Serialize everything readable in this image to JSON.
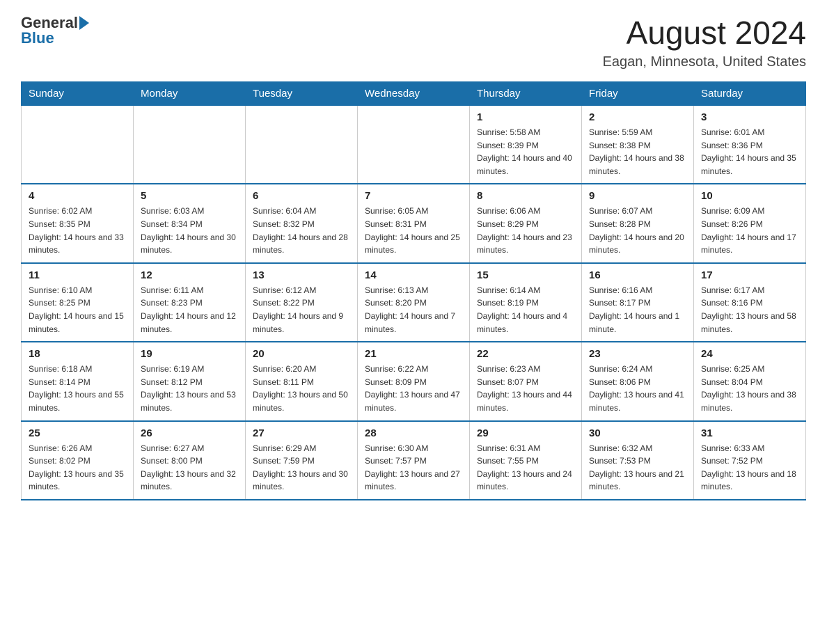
{
  "header": {
    "logo_text_general": "General",
    "logo_text_blue": "Blue",
    "month_year": "August 2024",
    "location": "Eagan, Minnesota, United States"
  },
  "days_of_week": [
    "Sunday",
    "Monday",
    "Tuesday",
    "Wednesday",
    "Thursday",
    "Friday",
    "Saturday"
  ],
  "weeks": [
    [
      {
        "day": "",
        "info": ""
      },
      {
        "day": "",
        "info": ""
      },
      {
        "day": "",
        "info": ""
      },
      {
        "day": "",
        "info": ""
      },
      {
        "day": "1",
        "info": "Sunrise: 5:58 AM\nSunset: 8:39 PM\nDaylight: 14 hours and 40 minutes."
      },
      {
        "day": "2",
        "info": "Sunrise: 5:59 AM\nSunset: 8:38 PM\nDaylight: 14 hours and 38 minutes."
      },
      {
        "day": "3",
        "info": "Sunrise: 6:01 AM\nSunset: 8:36 PM\nDaylight: 14 hours and 35 minutes."
      }
    ],
    [
      {
        "day": "4",
        "info": "Sunrise: 6:02 AM\nSunset: 8:35 PM\nDaylight: 14 hours and 33 minutes."
      },
      {
        "day": "5",
        "info": "Sunrise: 6:03 AM\nSunset: 8:34 PM\nDaylight: 14 hours and 30 minutes."
      },
      {
        "day": "6",
        "info": "Sunrise: 6:04 AM\nSunset: 8:32 PM\nDaylight: 14 hours and 28 minutes."
      },
      {
        "day": "7",
        "info": "Sunrise: 6:05 AM\nSunset: 8:31 PM\nDaylight: 14 hours and 25 minutes."
      },
      {
        "day": "8",
        "info": "Sunrise: 6:06 AM\nSunset: 8:29 PM\nDaylight: 14 hours and 23 minutes."
      },
      {
        "day": "9",
        "info": "Sunrise: 6:07 AM\nSunset: 8:28 PM\nDaylight: 14 hours and 20 minutes."
      },
      {
        "day": "10",
        "info": "Sunrise: 6:09 AM\nSunset: 8:26 PM\nDaylight: 14 hours and 17 minutes."
      }
    ],
    [
      {
        "day": "11",
        "info": "Sunrise: 6:10 AM\nSunset: 8:25 PM\nDaylight: 14 hours and 15 minutes."
      },
      {
        "day": "12",
        "info": "Sunrise: 6:11 AM\nSunset: 8:23 PM\nDaylight: 14 hours and 12 minutes."
      },
      {
        "day": "13",
        "info": "Sunrise: 6:12 AM\nSunset: 8:22 PM\nDaylight: 14 hours and 9 minutes."
      },
      {
        "day": "14",
        "info": "Sunrise: 6:13 AM\nSunset: 8:20 PM\nDaylight: 14 hours and 7 minutes."
      },
      {
        "day": "15",
        "info": "Sunrise: 6:14 AM\nSunset: 8:19 PM\nDaylight: 14 hours and 4 minutes."
      },
      {
        "day": "16",
        "info": "Sunrise: 6:16 AM\nSunset: 8:17 PM\nDaylight: 14 hours and 1 minute."
      },
      {
        "day": "17",
        "info": "Sunrise: 6:17 AM\nSunset: 8:16 PM\nDaylight: 13 hours and 58 minutes."
      }
    ],
    [
      {
        "day": "18",
        "info": "Sunrise: 6:18 AM\nSunset: 8:14 PM\nDaylight: 13 hours and 55 minutes."
      },
      {
        "day": "19",
        "info": "Sunrise: 6:19 AM\nSunset: 8:12 PM\nDaylight: 13 hours and 53 minutes."
      },
      {
        "day": "20",
        "info": "Sunrise: 6:20 AM\nSunset: 8:11 PM\nDaylight: 13 hours and 50 minutes."
      },
      {
        "day": "21",
        "info": "Sunrise: 6:22 AM\nSunset: 8:09 PM\nDaylight: 13 hours and 47 minutes."
      },
      {
        "day": "22",
        "info": "Sunrise: 6:23 AM\nSunset: 8:07 PM\nDaylight: 13 hours and 44 minutes."
      },
      {
        "day": "23",
        "info": "Sunrise: 6:24 AM\nSunset: 8:06 PM\nDaylight: 13 hours and 41 minutes."
      },
      {
        "day": "24",
        "info": "Sunrise: 6:25 AM\nSunset: 8:04 PM\nDaylight: 13 hours and 38 minutes."
      }
    ],
    [
      {
        "day": "25",
        "info": "Sunrise: 6:26 AM\nSunset: 8:02 PM\nDaylight: 13 hours and 35 minutes."
      },
      {
        "day": "26",
        "info": "Sunrise: 6:27 AM\nSunset: 8:00 PM\nDaylight: 13 hours and 32 minutes."
      },
      {
        "day": "27",
        "info": "Sunrise: 6:29 AM\nSunset: 7:59 PM\nDaylight: 13 hours and 30 minutes."
      },
      {
        "day": "28",
        "info": "Sunrise: 6:30 AM\nSunset: 7:57 PM\nDaylight: 13 hours and 27 minutes."
      },
      {
        "day": "29",
        "info": "Sunrise: 6:31 AM\nSunset: 7:55 PM\nDaylight: 13 hours and 24 minutes."
      },
      {
        "day": "30",
        "info": "Sunrise: 6:32 AM\nSunset: 7:53 PM\nDaylight: 13 hours and 21 minutes."
      },
      {
        "day": "31",
        "info": "Sunrise: 6:33 AM\nSunset: 7:52 PM\nDaylight: 13 hours and 18 minutes."
      }
    ]
  ]
}
